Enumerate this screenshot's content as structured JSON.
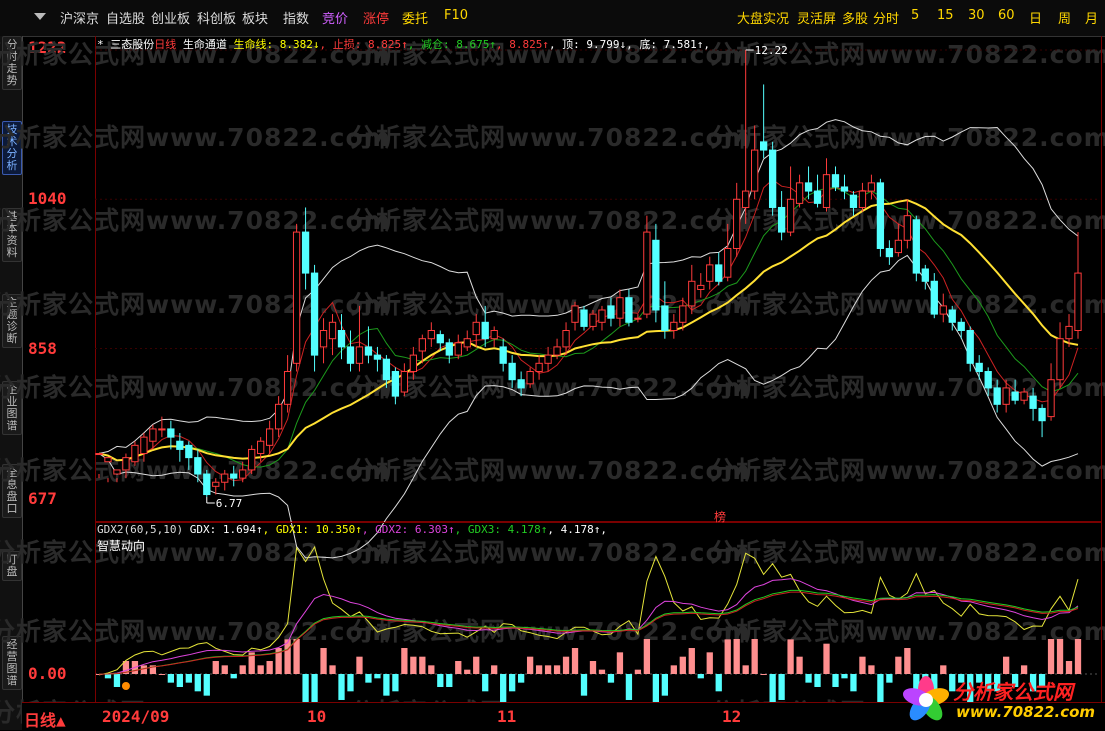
{
  "topbar": {
    "left_items": [
      "沪深京",
      "自选股",
      "创业板",
      "科创板",
      "板块",
      "指数",
      "竞价",
      "涨停",
      "委托",
      "F10"
    ],
    "left_colors": [
      "#dddddd",
      "#dddddd",
      "#dddddd",
      "#dddddd",
      "#dddddd",
      "#dddddd",
      "#d060ff",
      "#ff3b3b",
      "#ffd700",
      "#ffd700"
    ],
    "right_items": [
      "大盘实况",
      "灵活屏",
      "多股",
      "分时",
      "5",
      "15",
      "30",
      "60",
      "日",
      "周",
      "月"
    ]
  },
  "sidebar": {
    "tabs": [
      "分时走势",
      "技术分析",
      "基本资料",
      "主题诊断",
      "企业图谱",
      "全息盘口",
      "盯盘",
      "经营图谱"
    ],
    "active_index": 1
  },
  "price_axis": {
    "labels": [
      "1222",
      "1040",
      "858",
      "677"
    ]
  },
  "main_legend": [
    {
      "text": "*",
      "color": "#ffffff"
    },
    {
      "text": " 三态股份",
      "color": "#ffffff"
    },
    {
      "text": "日线",
      "color": "#ff3b3b"
    },
    {
      "text": " 生命通道",
      "color": "#ffffff"
    },
    {
      "text": " 生命线: 8.382↓",
      "color": "#ffff00"
    },
    {
      "text": ", 止损: 8.825↑",
      "color": "#ff3b3b"
    },
    {
      "text": ", 减仓: 8.675↑",
      "color": "#22cc22"
    },
    {
      "text": ", 8.825↑",
      "color": "#ff3b3b"
    },
    {
      "text": ", 顶: 9.799↓",
      "color": "#ffffff"
    },
    {
      "text": ", 底: 7.581↑",
      "color": "#ffffff"
    },
    {
      "text": ",",
      "color": "#ffffff"
    }
  ],
  "annotations": {
    "high_label": "12.22",
    "low_label": "6.77",
    "bang": "榜"
  },
  "indicator": {
    "legend_line1": [
      {
        "text": "GDX2(60,5,10)",
        "color": "#dddddd"
      },
      {
        "text": " GDX: 1.694↑",
        "color": "#ffffff"
      },
      {
        "text": ", GDX1: 10.350↑",
        "color": "#ffff00"
      },
      {
        "text": ", GDX2: 6.303↑",
        "color": "#dd44dd"
      },
      {
        "text": ", GDX3: 4.178↑",
        "color": "#22cc22"
      },
      {
        "text": ", 4.178↑",
        "color": "#ffffff"
      },
      {
        "text": ",",
        "color": "#ffffff"
      }
    ],
    "legend_line2": "智慧动向",
    "axis_label": "0.00"
  },
  "bottom": {
    "period": "日线▲",
    "months": [
      "2024/09",
      "10",
      "11",
      "12"
    ]
  },
  "watermark": "分析家公式网www.70822.com",
  "logo": {
    "line1": "分析家公式网",
    "line2": "www.70822.com"
  },
  "colors": {
    "up": "#ff3b3b",
    "down": "#54ffff",
    "lifeline": "#ffe033",
    "channel": "#dddddd",
    "stop": "#cc2222",
    "reduce": "#1c9a1c"
  },
  "chart_data": {
    "type": "candlestick",
    "price_range": [
      6.77,
      12.22
    ],
    "candles": [
      [
        7.3,
        7.3,
        7.05,
        7.0
      ],
      [
        7.2,
        7.25,
        7.0,
        6.95
      ],
      [
        7.05,
        7.1,
        7.0,
        6.95
      ],
      [
        7.1,
        7.25,
        7.3,
        7.0
      ],
      [
        7.2,
        7.4,
        7.45,
        7.15
      ],
      [
        7.3,
        7.5,
        7.55,
        7.2
      ],
      [
        7.45,
        7.6,
        7.65,
        7.35
      ],
      [
        7.6,
        7.6,
        7.75,
        7.5
      ],
      [
        7.6,
        7.5,
        7.7,
        7.35
      ],
      [
        7.45,
        7.35,
        7.55,
        7.2
      ],
      [
        7.4,
        7.25,
        7.45,
        7.1
      ],
      [
        7.25,
        7.05,
        7.35,
        6.95
      ],
      [
        7.05,
        6.8,
        7.1,
        6.77
      ],
      [
        6.9,
        6.95,
        7.0,
        6.8
      ],
      [
        6.95,
        7.05,
        7.1,
        6.85
      ],
      [
        7.05,
        7.0,
        7.15,
        6.9
      ],
      [
        7.0,
        7.1,
        7.2,
        6.95
      ],
      [
        7.1,
        7.35,
        7.4,
        7.05
      ],
      [
        7.3,
        7.45,
        7.5,
        7.2
      ],
      [
        7.4,
        7.6,
        7.7,
        7.3
      ],
      [
        7.6,
        7.9,
        8.0,
        7.5
      ],
      [
        7.9,
        8.3,
        8.5,
        7.8
      ],
      [
        8.4,
        10.0,
        10.1,
        8.3
      ],
      [
        10.0,
        9.5,
        10.3,
        9.3
      ],
      [
        9.5,
        8.5,
        9.6,
        8.3
      ],
      [
        8.6,
        8.8,
        8.95,
        8.4
      ],
      [
        8.7,
        8.9,
        9.0,
        8.5
      ],
      [
        8.8,
        8.6,
        9.0,
        8.45
      ],
      [
        8.6,
        8.4,
        8.8,
        8.3
      ],
      [
        8.4,
        8.6,
        9.1,
        8.3
      ],
      [
        8.6,
        8.5,
        8.85,
        8.4
      ],
      [
        8.5,
        8.45,
        8.6,
        8.3
      ],
      [
        8.45,
        8.2,
        8.5,
        8.1
      ],
      [
        8.3,
        8.0,
        8.35,
        7.9
      ],
      [
        8.05,
        8.3,
        8.4,
        8.0
      ],
      [
        8.3,
        8.5,
        8.6,
        8.2
      ],
      [
        8.55,
        8.7,
        8.75,
        8.4
      ],
      [
        8.7,
        8.8,
        8.9,
        8.6
      ],
      [
        8.75,
        8.65,
        8.8,
        8.55
      ],
      [
        8.65,
        8.5,
        8.7,
        8.4
      ],
      [
        8.5,
        8.65,
        8.75,
        8.45
      ],
      [
        8.6,
        8.7,
        8.8,
        8.55
      ],
      [
        8.75,
        8.9,
        9.0,
        8.6
      ],
      [
        8.9,
        8.7,
        9.1,
        8.6
      ],
      [
        8.7,
        8.8,
        8.85,
        8.6
      ],
      [
        8.6,
        8.4,
        8.7,
        8.3
      ],
      [
        8.4,
        8.2,
        8.5,
        8.1
      ],
      [
        8.2,
        8.1,
        8.3,
        8.0
      ],
      [
        8.15,
        8.3,
        8.35,
        8.1
      ],
      [
        8.3,
        8.4,
        8.5,
        8.2
      ],
      [
        8.4,
        8.5,
        8.6,
        8.3
      ],
      [
        8.5,
        8.6,
        8.7,
        8.45
      ],
      [
        8.6,
        8.8,
        8.9,
        8.5
      ],
      [
        8.9,
        9.1,
        9.15,
        8.8
      ],
      [
        9.05,
        8.85,
        9.1,
        8.8
      ],
      [
        8.85,
        9.0,
        9.05,
        8.8
      ],
      [
        8.9,
        9.05,
        9.1,
        8.8
      ],
      [
        9.1,
        8.95,
        9.2,
        8.85
      ],
      [
        8.95,
        9.2,
        9.3,
        8.85
      ],
      [
        9.2,
        8.9,
        9.3,
        8.85
      ],
      [
        8.95,
        8.95,
        9.0,
        8.9
      ],
      [
        9.0,
        10.0,
        10.2,
        8.95
      ],
      [
        9.9,
        9.05,
        10.1,
        8.9
      ],
      [
        9.1,
        8.8,
        9.4,
        8.7
      ],
      [
        8.8,
        8.9,
        9.0,
        8.7
      ],
      [
        8.9,
        9.1,
        9.2,
        8.8
      ],
      [
        9.1,
        9.4,
        9.6,
        9.0
      ],
      [
        9.3,
        9.35,
        9.5,
        9.2
      ],
      [
        9.4,
        9.6,
        9.7,
        9.3
      ],
      [
        9.6,
        9.4,
        9.75,
        9.35
      ],
      [
        9.45,
        9.8,
        10.1,
        9.4
      ],
      [
        9.8,
        10.4,
        10.6,
        9.7
      ],
      [
        10.3,
        10.5,
        12.22,
        10.1
      ],
      [
        10.5,
        11.0,
        11.3,
        10.4
      ],
      [
        11.1,
        11.0,
        11.8,
        10.9
      ],
      [
        11.0,
        10.3,
        11.1,
        10.2
      ],
      [
        10.3,
        10.0,
        10.5,
        9.9
      ],
      [
        10.0,
        10.4,
        10.8,
        9.95
      ],
      [
        10.35,
        10.6,
        10.7,
        10.3
      ],
      [
        10.6,
        10.5,
        10.8,
        10.4
      ],
      [
        10.5,
        10.35,
        10.7,
        10.3
      ],
      [
        10.3,
        10.7,
        10.9,
        10.25
      ],
      [
        10.7,
        10.55,
        10.8,
        10.5
      ],
      [
        10.55,
        10.5,
        10.7,
        10.4
      ],
      [
        10.45,
        10.3,
        10.5,
        10.2
      ],
      [
        10.3,
        10.5,
        10.6,
        10.25
      ],
      [
        10.5,
        10.6,
        10.7,
        10.4
      ],
      [
        10.6,
        9.8,
        10.65,
        9.7
      ],
      [
        9.8,
        9.7,
        9.9,
        9.6
      ],
      [
        9.75,
        9.9,
        10.1,
        9.7
      ],
      [
        9.9,
        10.2,
        10.4,
        9.8
      ],
      [
        10.15,
        9.5,
        10.2,
        9.4
      ],
      [
        9.55,
        9.4,
        9.6,
        9.3
      ],
      [
        9.4,
        9.0,
        9.5,
        8.95
      ],
      [
        9.0,
        9.1,
        9.25,
        8.9
      ],
      [
        9.05,
        8.9,
        9.1,
        8.8
      ],
      [
        8.9,
        8.8,
        8.95,
        8.7
      ],
      [
        8.8,
        8.4,
        8.85,
        8.3
      ],
      [
        8.4,
        8.3,
        8.5,
        8.2
      ],
      [
        8.3,
        8.1,
        8.35,
        8.0
      ],
      [
        8.1,
        7.9,
        8.2,
        7.8
      ],
      [
        7.9,
        8.1,
        8.2,
        7.8
      ],
      [
        8.05,
        7.95,
        8.2,
        7.9
      ],
      [
        7.95,
        8.05,
        8.1,
        7.9
      ],
      [
        8.0,
        7.85,
        8.1,
        7.7
      ],
      [
        7.85,
        7.7,
        7.9,
        7.5
      ],
      [
        7.75,
        8.2,
        8.4,
        7.7
      ],
      [
        8.2,
        8.7,
        8.9,
        8.1
      ],
      [
        8.7,
        8.85,
        9.0,
        8.6
      ],
      [
        8.8,
        9.5,
        10.0,
        8.7
      ]
    ]
  }
}
